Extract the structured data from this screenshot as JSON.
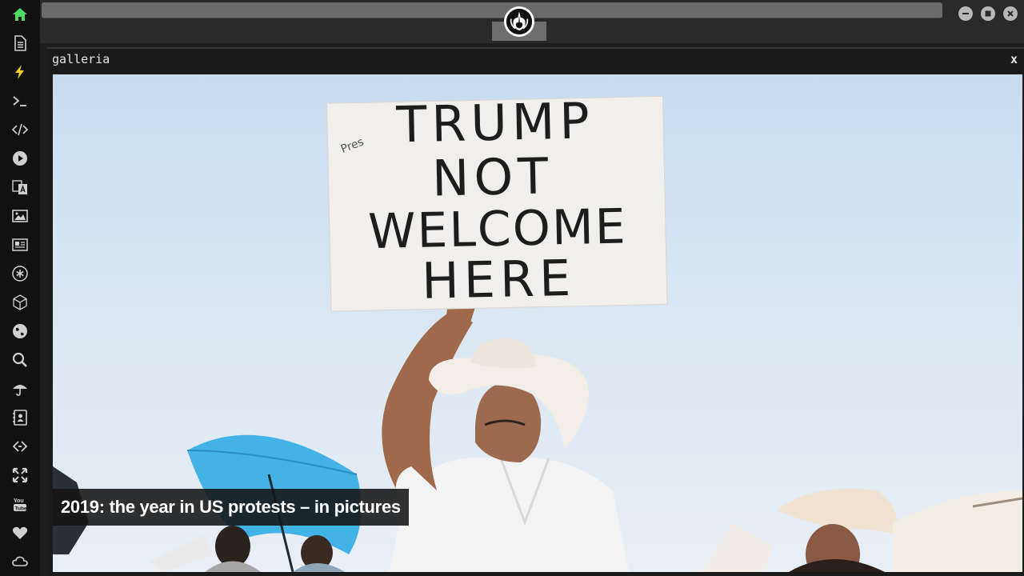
{
  "window": {
    "title": "galleria",
    "close_label": "x"
  },
  "sidebar": {
    "items": [
      {
        "icon": "home-icon",
        "color": "#4cd964"
      },
      {
        "icon": "document-icon",
        "color": "#d0d0d0"
      },
      {
        "icon": "lightning-icon",
        "color": "#f5d020"
      },
      {
        "icon": "terminal-icon",
        "color": "#d0d0d0"
      },
      {
        "icon": "code-icon",
        "color": "#d0d0d0"
      },
      {
        "icon": "play-icon",
        "color": "#d0d0d0"
      },
      {
        "icon": "translate-icon",
        "color": "#d0d0d0"
      },
      {
        "icon": "image-icon",
        "color": "#d0d0d0"
      },
      {
        "icon": "newspaper-icon",
        "color": "#d0d0d0"
      },
      {
        "icon": "asterisk-icon",
        "color": "#d0d0d0"
      },
      {
        "icon": "cube-icon",
        "color": "#d0d0d0"
      },
      {
        "icon": "globe-icon",
        "color": "#d0d0d0"
      },
      {
        "icon": "search-icon",
        "color": "#d0d0d0"
      },
      {
        "icon": "umbrella-icon",
        "color": "#d0d0d0"
      },
      {
        "icon": "contact-book-icon",
        "color": "#d0d0d0"
      },
      {
        "icon": "code-fork-icon",
        "color": "#d0d0d0"
      },
      {
        "icon": "expand-icon",
        "color": "#d0d0d0"
      },
      {
        "icon": "youtube-icon",
        "color": "#d0d0d0"
      },
      {
        "icon": "heart-icon",
        "color": "#d0d0d0"
      },
      {
        "icon": "cloud-icon",
        "color": "#d0d0d0"
      }
    ]
  },
  "gallery": {
    "caption": "2019: the year in US protests – in pictures",
    "sign_lines": [
      "TRUMP",
      "NOT",
      "WELCOME",
      "HERE"
    ],
    "sign_small": "Pres"
  }
}
